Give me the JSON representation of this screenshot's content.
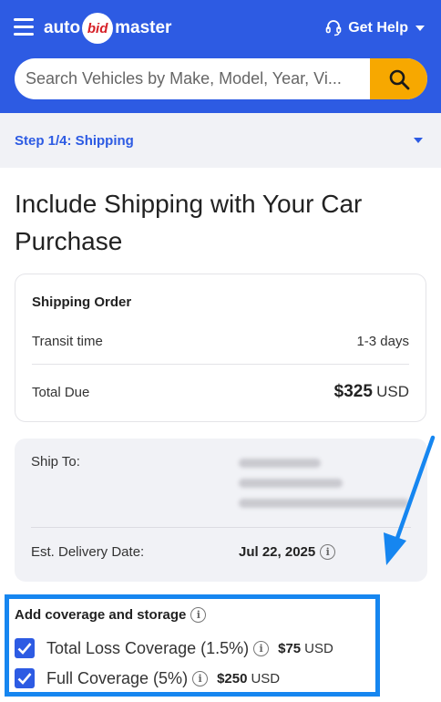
{
  "header": {
    "logo": {
      "part1": "auto",
      "part2": "bid",
      "part3": "master"
    },
    "help_label": "Get Help",
    "search": {
      "placeholder": "Search Vehicles by Make, Model, Year, Vi..."
    }
  },
  "step": {
    "label": "Step 1/4: Shipping"
  },
  "page_title": "Include Shipping with Your Car Purchase",
  "shipping_order": {
    "heading": "Shipping Order",
    "transit_label": "Transit time",
    "transit_value": "1-3 days",
    "total_label": "Total Due",
    "total_amount": "$325",
    "total_currency": "USD"
  },
  "ship_to": {
    "label": "Ship To:",
    "delivery_label": "Est. Delivery Date:",
    "delivery_date": "Jul 22, 2025"
  },
  "coverage": {
    "heading": "Add coverage and storage",
    "options": [
      {
        "label": "Total Loss Coverage (1.5%)",
        "amount": "$75",
        "currency": "USD",
        "checked": true
      },
      {
        "label": "Full Coverage (5%)",
        "amount": "$250",
        "currency": "USD",
        "checked": true
      }
    ]
  },
  "colors": {
    "brand_blue": "#2d5be3",
    "accent_orange": "#f7a800",
    "highlight_blue": "#1686f0",
    "logo_red": "#d61f26"
  }
}
